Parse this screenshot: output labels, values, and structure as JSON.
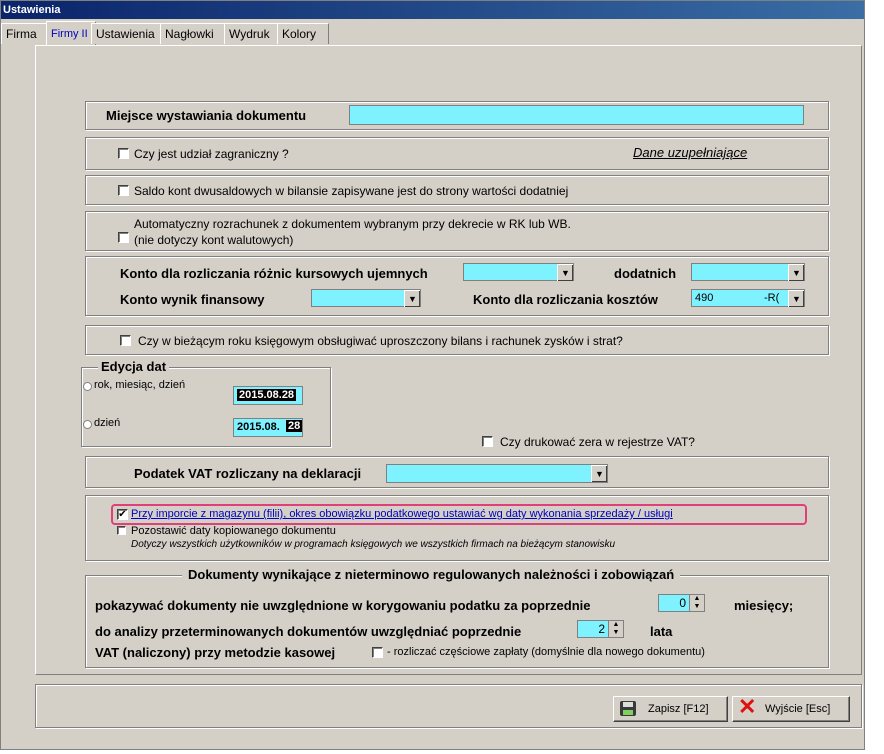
{
  "window": {
    "title": "Ustawienia"
  },
  "tabs": [
    "Firma",
    "Firmy II",
    "Ustawienia",
    "Nagłowki",
    "Wydruk",
    "Kolory"
  ],
  "place": {
    "label": "Miejsce wystawiania dokumentu",
    "value": ""
  },
  "foreign": {
    "label": "Czy jest udział zagraniczny ?",
    "checked": false,
    "link": "Dane uzupełniające"
  },
  "saldo": {
    "label": "Saldo kont dwusaldowych w bilansie zapisywane jest do strony wartości dodatniej",
    "checked": false
  },
  "auto": {
    "line1": "Automatyczny rozrachunek z dokumentem wybranym przy dekrecie w RK lub WB.",
    "line2": "(nie dotyczy kont walutowych)",
    "checked": false
  },
  "accounts": {
    "negative_label": "Konto dla rozliczania różnic kursowych ujemnych",
    "negative_value": "",
    "positive_label": "dodatnich",
    "positive_value": "",
    "result_label": "Konto wynik finansowy",
    "result_value": "",
    "costs_label": "Konto dla rozliczania kosztów",
    "costs_value": "490",
    "costs_suffix": "-R("
  },
  "simplified": {
    "label": "Czy w bieżącym roku księgowym obsługiwać uproszczony bilans i rachunek zysków i strat?",
    "checked": false
  },
  "dates": {
    "title": "Edycja dat",
    "opt1_label": "rok, miesiąc, dzień",
    "opt1_value": "2015.08.28",
    "opt2_label": "dzień",
    "opt2_prefix": "2015.08.",
    "opt2_day": "28",
    "zeros_label": "Czy drukować zera w rejestrze VAT?"
  },
  "vat": {
    "label": "Podatek VAT rozliczany na deklaracji",
    "value": ""
  },
  "import": {
    "label": "Przy imporcie z magazynu (filii), okres obowiązku podatkowego ustawiać wg daty wykonania sprzedaży / usługi",
    "checked": true,
    "check_mark": "✔",
    "leave_label": "Pozostawić daty kopiowanego dokumentu",
    "leave_note": "Dotyczy wszystkich użytkowników w programach księgowych we wszystkich firmach na bieżącym stanowisku"
  },
  "overdue": {
    "title": "Dokumenty wynikające z nieterminowo regulowanych należności i zobowiązań",
    "show_label": "pokazywać  dokumenty nie uwzględnione w korygowaniu podatku za poprzednie",
    "show_value": "0",
    "show_unit": "miesięcy;",
    "analysis_label": "do analizy przeterminowanych dokumentów uwzględniać poprzednie",
    "analysis_value": "2",
    "analysis_unit": "lata",
    "vat_cash_label": "VAT (naliczony) przy metodzie kasowej",
    "vat_cash_option": "- rozliczać częściowe zapłaty (domyślnie dla nowego dokumentu)"
  },
  "footer": {
    "save": "Zapisz  [F12]",
    "exit": "Wyjście  [Esc]"
  },
  "colors": {
    "field": "#7ef2ff",
    "highlight": "#e0407a",
    "accent_text": "#0000c0"
  }
}
